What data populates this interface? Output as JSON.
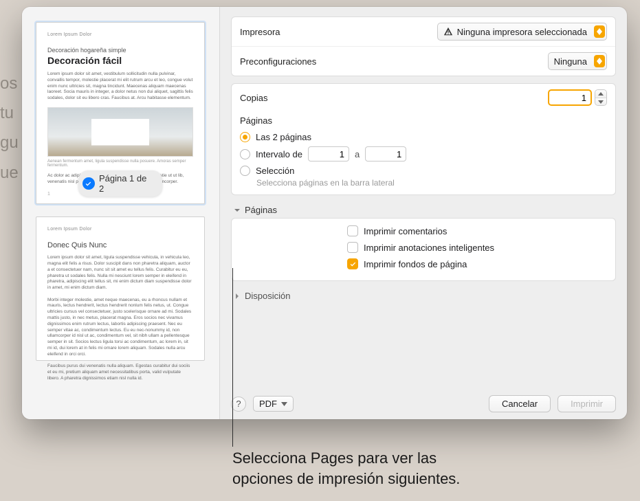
{
  "preview": {
    "header_small": "Lorem Ipsum Dolor",
    "subtitle": "Decoración hogareña simple",
    "title": "Decoración fácil",
    "page_label": "Página 1 de 2",
    "page2_title": "Donec Quis Nunc"
  },
  "printer": {
    "label": "Impresora",
    "value": "Ninguna impresora seleccionada"
  },
  "presets": {
    "label": "Preconfiguraciones",
    "value": "Ninguna"
  },
  "copies": {
    "label": "Copias",
    "value": "1"
  },
  "pages": {
    "label": "Páginas",
    "all_label": "Las 2 páginas",
    "range_label": "Intervalo de",
    "range_from": "1",
    "range_sep": "a",
    "range_to": "1",
    "selection_label": "Selección",
    "selection_hint": "Selecciona páginas en la barra lateral"
  },
  "pages_section": {
    "title": "Páginas",
    "print_comments": "Imprimir comentarios",
    "print_annotations": "Imprimir anotaciones inteligentes",
    "print_backgrounds": "Imprimir fondos de página"
  },
  "layout_section": {
    "title": "Disposición"
  },
  "footer": {
    "help": "?",
    "pdf": "PDF",
    "cancel": "Cancelar",
    "print": "Imprimir"
  },
  "callout": {
    "line1": "Selecciona Pages para ver las",
    "line2": "opciones de impresión siguientes."
  }
}
